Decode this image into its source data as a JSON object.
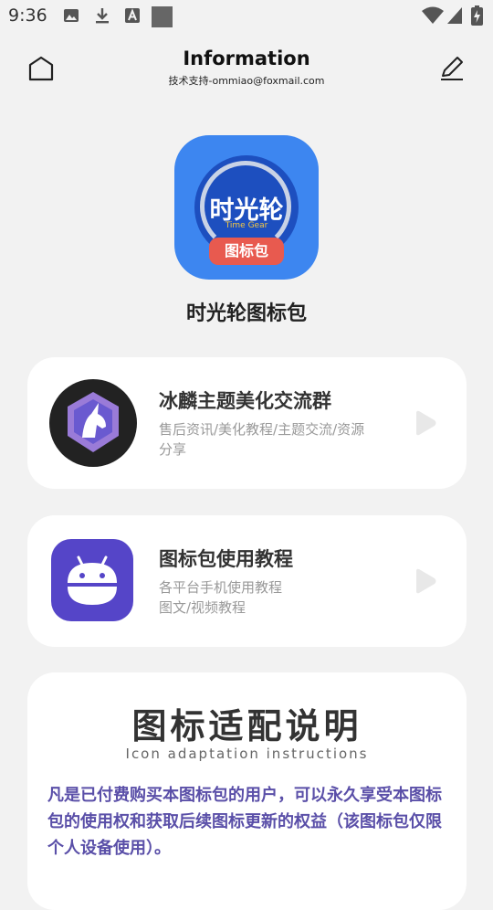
{
  "status_bar": {
    "time": "9:36"
  },
  "header": {
    "title": "Information",
    "subtitle": "技术支持-ommiao@foxmail.com"
  },
  "app": {
    "icon_text": "时光轮",
    "icon_subtext": "Time Gear",
    "icon_tag": "图标包",
    "name": "时光轮图标包"
  },
  "cards": [
    {
      "title": "冰麟主题美化交流群",
      "desc": "售后资讯/美化教程/主题交流/资源分享"
    },
    {
      "title": "图标包使用教程",
      "desc_lines": [
        "各平台手机使用教程",
        "图文/视频教程"
      ]
    }
  ],
  "rules": {
    "title": "图标适配说明",
    "subtitle": "Icon adaptation instructions",
    "body": "凡是已付费购买本图标包的用户，可以永久享受本图标包的使用权和获取后续图标更新的权益（该图标包仅限个人设备使用）。"
  },
  "colors": {
    "background": "#f2f2f2",
    "icon_blue": "#3d86f0",
    "tag_red": "#e85a4f",
    "rules_text": "#5a4fa8"
  }
}
